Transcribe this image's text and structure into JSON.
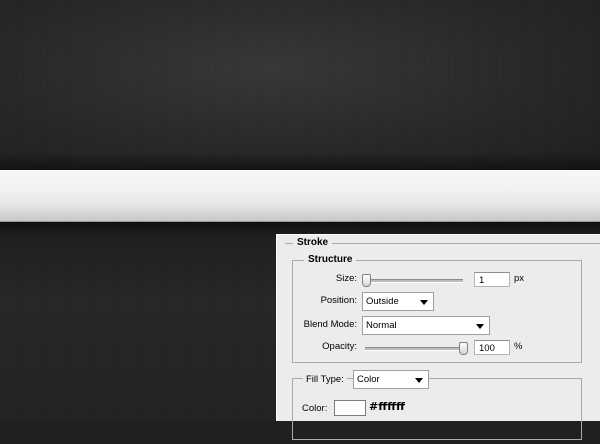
{
  "colors": {
    "canvas_dark": "#2a2a2a",
    "dialog_bg": "#ececec",
    "stroke_bar": "#f2f2f2"
  },
  "dialog": {
    "title": "Stroke",
    "structure": {
      "title": "Structure",
      "size_label": "Size:",
      "size_value": "1",
      "size_unit": "px",
      "position_label": "Position:",
      "position_value": "Outside",
      "blend_mode_label": "Blend Mode:",
      "blend_mode_value": "Normal",
      "opacity_label": "Opacity:",
      "opacity_value": "100",
      "opacity_unit": "%"
    },
    "fill": {
      "fill_type_label": "Fill Type:",
      "fill_type_value": "Color",
      "color_label": "Color:",
      "color_hex": "#ffffff"
    }
  }
}
